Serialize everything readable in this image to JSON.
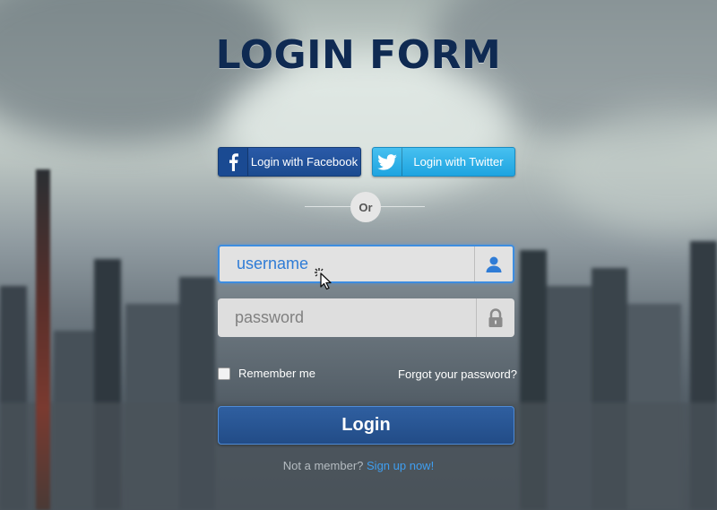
{
  "title": "LOGIN FORM",
  "social": {
    "facebook_label": "Login with Facebook",
    "twitter_label": "Login with Twitter"
  },
  "divider": {
    "label": "Or"
  },
  "username": {
    "value": "username",
    "icon": "user-icon"
  },
  "password": {
    "placeholder": "password",
    "icon": "lock-icon"
  },
  "remember": {
    "label": "Remember me",
    "checked": false
  },
  "forgot": {
    "label": "Forgot your password?"
  },
  "login_button": {
    "label": "Login"
  },
  "signup": {
    "prompt": "Not a member?",
    "link": "Sign up now!"
  },
  "colors": {
    "title": "#0f2a52",
    "facebook": "#1b4b8f",
    "twitter": "#1ea4e0",
    "login_button": "#224c87",
    "focus_border": "#3d8de0",
    "link": "#3f9ef0"
  }
}
